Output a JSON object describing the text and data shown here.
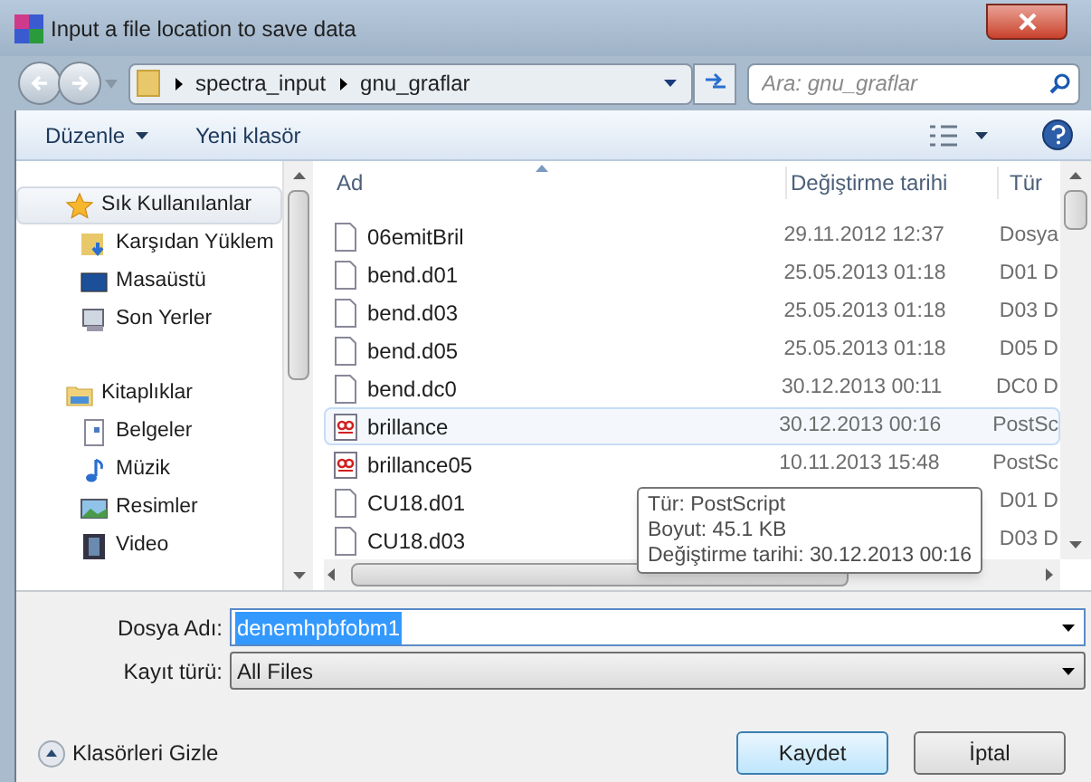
{
  "window": {
    "title": "Input a file location to save data"
  },
  "address": {
    "crumbs": [
      "spectra_input",
      "gnu_graflar"
    ],
    "search_placeholder": "Ara: gnu_graflar"
  },
  "toolbar": {
    "organize": "Düzenle",
    "new_folder": "Yeni klasör"
  },
  "sidebar": [
    {
      "label": "Sık Kullanılanlar",
      "kind": "star",
      "selected": true,
      "children": [
        {
          "label": "Karşıdan Yüklem",
          "kind": "download",
          "selected": false
        },
        {
          "label": "Masaüstü",
          "kind": "desktop",
          "selected": false
        },
        {
          "label": "Son Yerler",
          "kind": "recent",
          "selected": false
        }
      ]
    },
    {
      "label": "Kitaplıklar",
      "kind": "library",
      "selected": false,
      "children": [
        {
          "label": "Belgeler",
          "kind": "document",
          "selected": false
        },
        {
          "label": "Müzik",
          "kind": "music",
          "selected": false
        },
        {
          "label": "Resimler",
          "kind": "pictures",
          "selected": false
        },
        {
          "label": "Video",
          "kind": "video",
          "selected": false
        }
      ]
    }
  ],
  "table": {
    "columns": [
      "Ad",
      "Değiştirme tarihi",
      "Tür"
    ],
    "rows": [
      {
        "name": "06emitBril",
        "date": "29.11.2012 12:37",
        "type": "Dosya",
        "kind": "file",
        "selected": false
      },
      {
        "name": "bend.d01",
        "date": "25.05.2013 01:18",
        "type": "D01 D",
        "kind": "file",
        "selected": false
      },
      {
        "name": "bend.d03",
        "date": "25.05.2013 01:18",
        "type": "D03 D",
        "kind": "file",
        "selected": false
      },
      {
        "name": "bend.d05",
        "date": "25.05.2013 01:18",
        "type": "D05 D",
        "kind": "file",
        "selected": false
      },
      {
        "name": "bend.dc0",
        "date": "30.12.2013 00:11",
        "type": "DC0 D",
        "kind": "file",
        "selected": false
      },
      {
        "name": "brillance",
        "date": "30.12.2013 00:16",
        "type": "PostSc",
        "kind": "postscript",
        "selected": true
      },
      {
        "name": "brillance05",
        "date": "10.11.2013 15:48",
        "type": "PostSc",
        "kind": "postscript",
        "selected": false
      },
      {
        "name": "CU18.d01",
        "type": "D01 D",
        "kind": "file",
        "selected": false
      },
      {
        "name": "CU18.d03",
        "type": "D03 D",
        "kind": "file",
        "selected": false
      }
    ]
  },
  "tooltip": [
    "Tür: PostScript",
    "Boyut: 45.1 KB",
    "Değiştirme tarihi: 30.12.2013 00:16"
  ],
  "form": {
    "filename_label": "Dosya Adı:",
    "filename": "denemhpbfobm1",
    "type_label": "Kayıt türü:",
    "type": "All Files"
  },
  "footer": {
    "hide_folders": "Klasörleri Gizle",
    "save": "Kaydet",
    "cancel": "İptal"
  }
}
